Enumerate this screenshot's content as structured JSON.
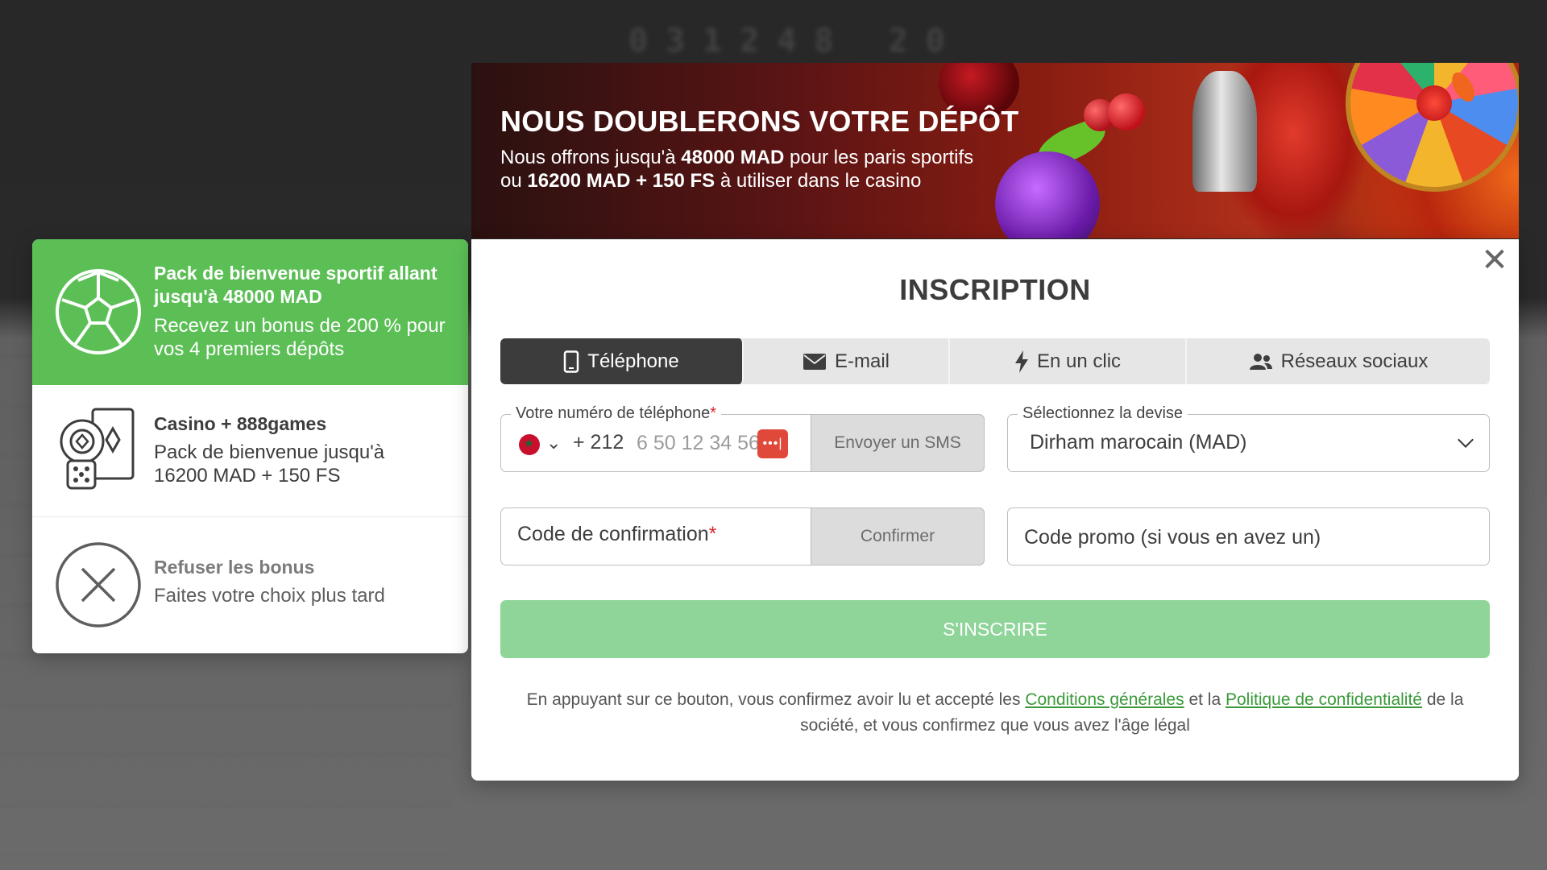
{
  "banner": {
    "title": "NOUS DOUBLERONS VOTRE DÉPÔT",
    "line1_pre": "Nous offrons jusqu'à ",
    "line1_bold": "48000 MAD",
    "line1_post": " pour les paris sportifs",
    "line2_pre": "ou ",
    "line2_bold": "16200 MAD + 150 FS",
    "line2_post": " à utiliser dans le casino"
  },
  "bonuses": [
    {
      "title": "Pack de bienvenue sportif allant jusqu'à 48000 MAD",
      "desc": "Recevez un bonus de 200 % pour vos 4 premiers dépôts",
      "icon": "soccer-ball-icon",
      "selected": true
    },
    {
      "title": "Casino + 888games",
      "desc": "Pack de bienvenue jusqu'à 16200 MAD + 150 FS",
      "icon": "casino-chips-cards-icon",
      "selected": false
    },
    {
      "title": "Refuser les bonus",
      "desc": "Faites votre choix plus tard",
      "icon": "close-circle-icon",
      "selected": false
    }
  ],
  "modal": {
    "title": "INSCRIPTION",
    "close_label": "✕",
    "tabs": [
      {
        "label": "Téléphone",
        "icon": "phone-icon",
        "active": true
      },
      {
        "label": "E-mail",
        "icon": "envelope-icon",
        "active": false
      },
      {
        "label": "En un clic",
        "icon": "lightning-icon",
        "active": false
      },
      {
        "label": "Réseaux sociaux",
        "icon": "users-icon",
        "active": false
      }
    ],
    "phone": {
      "legend": "Votre numéro de téléphone",
      "required_mark": "*",
      "country_flag": "morocco-flag-icon",
      "dial_code": "+ 212",
      "placeholder": "6 50 12 34 56",
      "autofill_icon_text": "•••|",
      "sms_button": "Envoyer un SMS"
    },
    "currency": {
      "legend": "Sélectionnez la devise",
      "value": "Dirham marocain (MAD)"
    },
    "confirmation": {
      "label": "Code de confirmation",
      "required_mark": "*",
      "button": "Confirmer"
    },
    "promo": {
      "placeholder": "Code promo (si vous en avez un)"
    },
    "submit_label": "S'INSCRIRE",
    "legal": {
      "part1": "En appuyant sur ce bouton, vous confirmez avoir lu et accepté les ",
      "link1": "Conditions générales",
      "part2": " et la ",
      "link2": "Politique de confidentialité",
      "part3": " de la société, et vous confirmez que vous avez l'âge légal"
    }
  },
  "colors": {
    "accent_green": "#5cbf56",
    "submit_disabled": "#8fd59a",
    "tab_active": "#3c3c3c",
    "link_green": "#3a9a3a",
    "required_red": "#d8262c"
  }
}
